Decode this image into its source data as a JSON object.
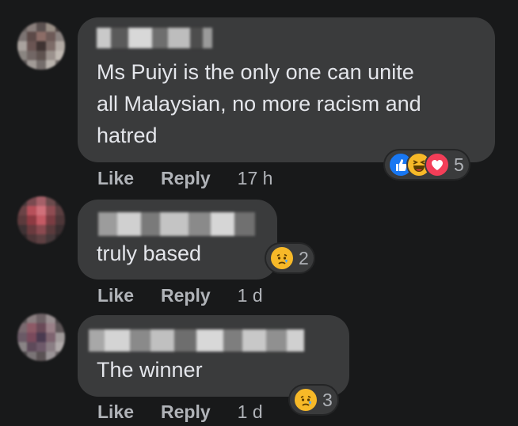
{
  "comments": [
    {
      "text": "Ms Puiyi is the only one can unite\nall Malaysian, no more racism and\nhatred",
      "actions": {
        "like": "Like",
        "reply": "Reply",
        "time": "17 h"
      },
      "reactions": {
        "icons": [
          "like-icon",
          "haha-icon",
          "love-icon"
        ],
        "count": "5"
      }
    },
    {
      "text": "truly based",
      "actions": {
        "like": "Like",
        "reply": "Reply",
        "time": "1 d"
      },
      "reactions": {
        "icons": [
          "sad-icon"
        ],
        "count": "2"
      }
    },
    {
      "text": "The winner",
      "actions": {
        "like": "Like",
        "reply": "Reply",
        "time": "1 d"
      },
      "reactions": {
        "icons": [
          "sad-icon"
        ],
        "count": "3"
      }
    }
  ],
  "colors": {
    "background": "#18191a",
    "bubble": "#3a3b3c",
    "text": "#e4e6eb",
    "secondary_text": "#b0b3b8",
    "like_blue": "#1877f2",
    "love_red": "#f33e58",
    "emoji_yellow": "#f7b928"
  }
}
